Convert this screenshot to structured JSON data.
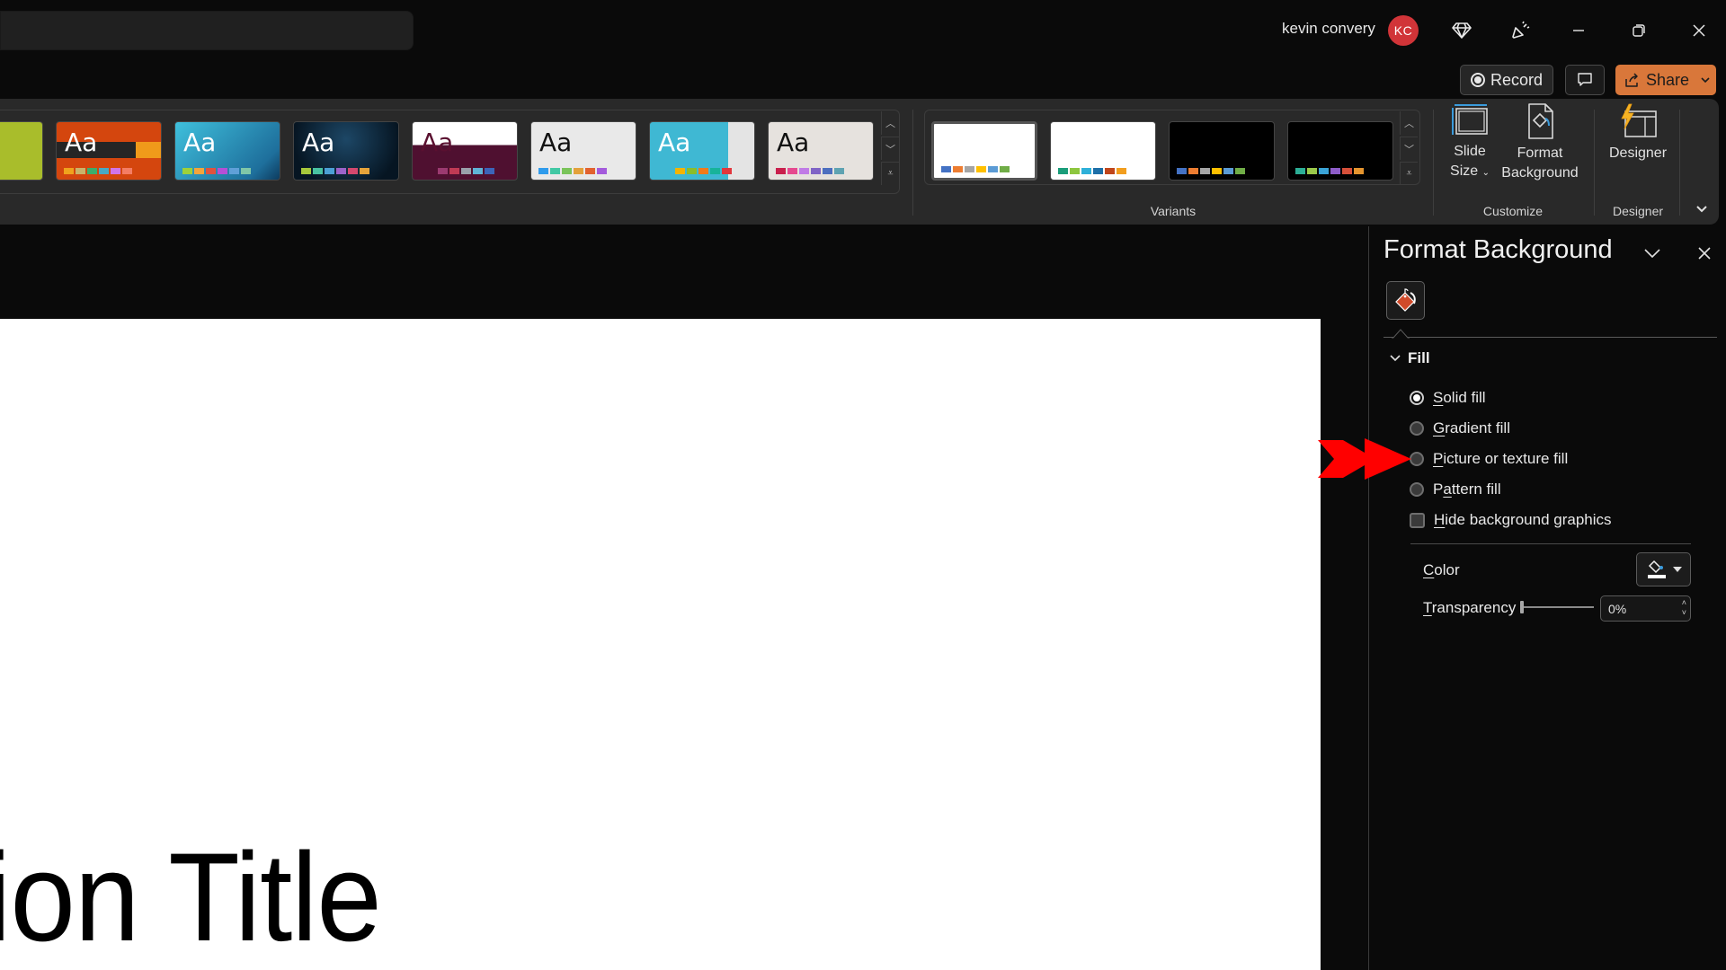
{
  "titlebar": {
    "user_name": "kevin convery",
    "avatar_initials": "KC",
    "avatar_color": "#d13438",
    "icons": [
      "premium-diamond-icon",
      "feedback-megaphone-icon",
      "minimize-icon",
      "restore-icon",
      "close-icon"
    ]
  },
  "actions": {
    "record_label": "Record",
    "comments_icon": "comment-icon",
    "share_label": "Share",
    "share_color": "#d9773a"
  },
  "ribbon": {
    "themes": [
      {
        "name": "Green theme",
        "aa": "",
        "bg": "#a9bd2b",
        "fg": "#ffffff",
        "swatches": [
          "#d6d03a",
          "#8a8f95"
        ]
      },
      {
        "name": "Orange banded theme",
        "aa": "Aa",
        "bg": "#d4460e",
        "fg": "#ffffff",
        "swatches": [
          "#f0a21d",
          "#c9b36a",
          "#3bae6b",
          "#49a9c4",
          "#d175e8",
          "#f47d63"
        ]
      },
      {
        "name": "Blue gradient theme",
        "aa": "Aa",
        "bg": "#2a9ec4",
        "fg": "#ffffff",
        "swatches": [
          "#9ed13a",
          "#f3a53b",
          "#e0523d",
          "#b54fd6",
          "#5fa0d8",
          "#80c7a8"
        ]
      },
      {
        "name": "Dark navy theme",
        "aa": "Aa",
        "bg": "#0f2438",
        "fg": "#ffffff",
        "swatches": [
          "#a7c83b",
          "#48c2a2",
          "#4ba0d5",
          "#9b63c9",
          "#d4486e",
          "#e6a43a"
        ]
      },
      {
        "name": "Maroon theme",
        "aa": "Aa",
        "bg": "#4f1030",
        "fg": "#5a1030",
        "swatches": [
          "#9b3a70",
          "#c03a54",
          "#9aa1ab",
          "#5fb4d6",
          "#3c64b8"
        ]
      },
      {
        "name": "Droplet theme",
        "aa": "Aa",
        "bg": "#e9e9e9",
        "fg": "#111111",
        "swatches": [
          "#2f9bec",
          "#41c8a4",
          "#7ac45a",
          "#e3a13b",
          "#e2622f",
          "#a45bdc"
        ]
      },
      {
        "name": "Teal block theme",
        "aa": "Aa",
        "bg": "#3fb8d3",
        "fg": "#ffffff",
        "swatches": [
          "#f4b400",
          "#8bbd2b",
          "#f07b1a",
          "#17b39a",
          "#e2373d"
        ]
      },
      {
        "name": "Wood theme",
        "aa": "Aa",
        "bg": "#e6e2de",
        "fg": "#111111",
        "swatches": [
          "#c91f4c",
          "#e6498f",
          "#c07be6",
          "#8064c6",
          "#4d6fbf",
          "#5fa3b2"
        ]
      }
    ],
    "variants": [
      {
        "bg": "#ffffff",
        "swatches": [
          "#4472c4",
          "#ed7d31",
          "#a5a5a5",
          "#ffc000",
          "#5b9bd5",
          "#70ad47"
        ],
        "selected": true
      },
      {
        "bg": "#ffffff",
        "swatches": [
          "#1a9d7a",
          "#8dc63f",
          "#2eb0d9",
          "#1d6fa8",
          "#c0461b",
          "#f29e1e"
        ],
        "selected": false
      },
      {
        "bg": "#000000",
        "swatches": [
          "#4472c4",
          "#ed7d31",
          "#a5a5a5",
          "#ffc000",
          "#5b9bd5",
          "#70ad47"
        ],
        "selected": false
      },
      {
        "bg": "#000000",
        "swatches": [
          "#2cae96",
          "#9ac84a",
          "#3aa3d6",
          "#8d5cc8",
          "#d6503a",
          "#e5952f"
        ],
        "selected": false
      }
    ],
    "variants_label": "Variants",
    "customize_label": "Customize",
    "designer_group_label": "Designer",
    "slide_size_line1": "Slide",
    "slide_size_line2": "Size",
    "format_bg_line1": "Format",
    "format_bg_line2": "Background",
    "designer_label": "Designer"
  },
  "slide": {
    "title_visible": "ntation Title"
  },
  "pane": {
    "title": "Format Background",
    "fill_section": "Fill",
    "options": [
      {
        "label": "Solid fill",
        "accel": "S",
        "type": "radio",
        "checked": true
      },
      {
        "label": "Gradient fill",
        "accel": "G",
        "type": "radio",
        "checked": false
      },
      {
        "label": "Picture or texture fill",
        "accel": "P",
        "type": "radio",
        "checked": false
      },
      {
        "label": "Pattern fill",
        "accel": "a",
        "type": "radio",
        "checked": false
      },
      {
        "label": "Hide background graphics",
        "accel": "H",
        "type": "checkbox",
        "checked": false
      }
    ],
    "color_label": "Color",
    "transparency_label": "Transparency",
    "transparency_value": "0%",
    "transparency_fraction": 0
  },
  "annotation": {
    "arrow_color": "#ff0000",
    "points_to": "Picture or texture fill"
  }
}
